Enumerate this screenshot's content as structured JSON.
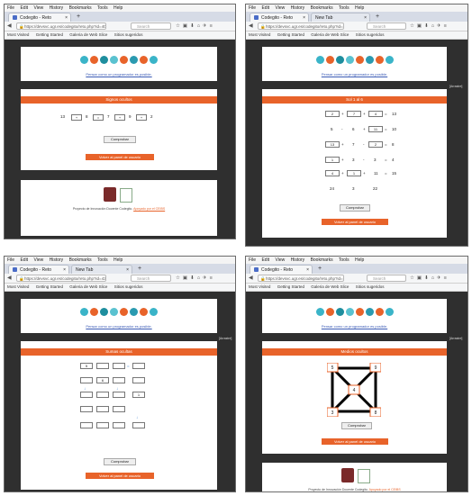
{
  "browser": {
    "menu": [
      "File",
      "Edit",
      "View",
      "History",
      "Bookmarks",
      "Tools",
      "Help"
    ],
    "tab_title": "Codegito - Reto",
    "new_tab_title": "New Tab",
    "search_placeholder": "Search",
    "bookmarks": [
      "Most Visited",
      "Getting Started",
      "Galeria de Web Slice",
      "Sitios sugeridos"
    ],
    "url_host": "https://devsvc.ugr.es/codegito/reto.php?id=",
    "url_ids": [
      "40",
      "44",
      "43",
      "7"
    ]
  },
  "site": {
    "logo_text": "CODEGITO",
    "subtitle_link": "Pensar como un programador es posible.",
    "check_button": "Comprobar",
    "next_button": "Volver al panel de usuario",
    "side_badge": "[Arrastre]"
  },
  "panels": [
    {
      "title": "Signos ocultos",
      "equation": [
        "13",
        "+",
        "8",
        "=",
        "7",
        "+",
        "9",
        "+",
        "2"
      ]
    },
    {
      "title": "Sol 1 al 6",
      "grid": [
        [
          "2",
          "+",
          "7",
          "+",
          "4",
          "=",
          "13"
        ],
        [
          "5",
          "-",
          "6",
          "+",
          "11",
          "=",
          "10"
        ],
        [
          "13",
          "+",
          "7",
          "-",
          "2",
          "=",
          "8"
        ],
        [
          "1",
          "+",
          "3",
          "-",
          "3",
          "=",
          "4"
        ],
        [
          "4",
          "+",
          "1",
          "+",
          "11",
          "=",
          "15"
        ],
        [
          "24",
          "",
          "3",
          "",
          "22",
          "",
          ""
        ]
      ]
    },
    {
      "title": "Sumas ocultas",
      "cells": [
        "5",
        "",
        "=",
        "6",
        "",
        "",
        "",
        "",
        "",
        "",
        "",
        "",
        "",
        "",
        "",
        "",
        "",
        "",
        "",
        "",
        "1"
      ]
    },
    {
      "title": "Medios ocultos",
      "node_values": [
        "5",
        "9",
        "4",
        "3",
        "8"
      ]
    }
  ],
  "footer": {
    "text": "Proyecto de Innovación Docente Codegito.",
    "link": "Apoyado por el CEIBS"
  },
  "colors": {
    "accent": "#e8632a",
    "page_bg": "#2f2f2f"
  }
}
